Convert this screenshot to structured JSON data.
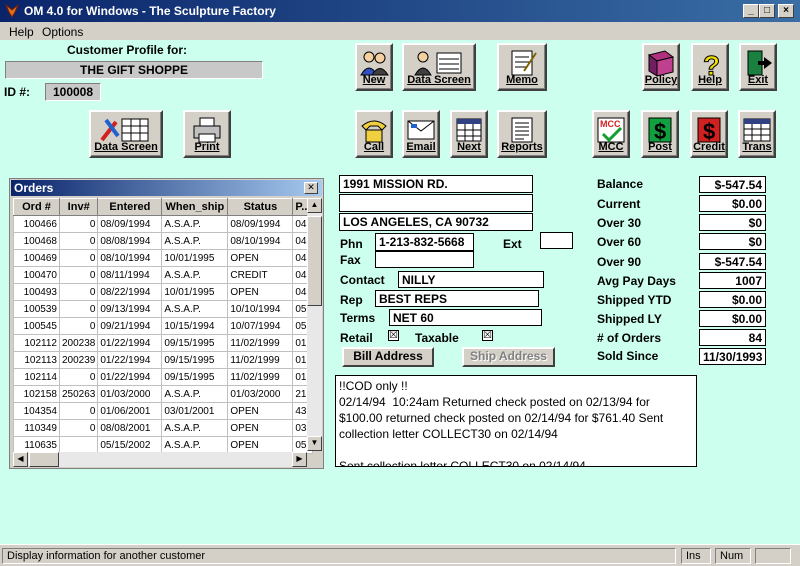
{
  "window": {
    "title": "OM 4.0 for Windows - The Sculpture Factory"
  },
  "menu": {
    "help": "Help",
    "options": "Options"
  },
  "profile": {
    "heading": "Customer Profile for:",
    "name": "THE GIFT SHOPPE",
    "id_label": "ID #:",
    "id": "100008"
  },
  "toolbar": {
    "new": "New",
    "data_screen": "Data Screen",
    "memo": "Memo",
    "policy": "Policy",
    "help": "Help",
    "exit": "Exit",
    "data_screen2": "Data Screen",
    "print": "Print",
    "call": "Call",
    "email": "Email",
    "next": "Next",
    "reports": "Reports",
    "mcc": "MCC",
    "post": "Post",
    "credit": "Credit",
    "trans": "Trans"
  },
  "orders": {
    "title": "Orders",
    "columns": [
      "Ord #",
      "Inv#",
      "Entered",
      "When_ship",
      "Status",
      "P..."
    ],
    "rows": [
      [
        "100466",
        "0",
        "08/09/1994",
        "A.S.A.P.",
        "08/09/1994",
        "04"
      ],
      [
        "100468",
        "0",
        "08/08/1994",
        "A.S.A.P.",
        "08/10/1994",
        "04"
      ],
      [
        "100469",
        "0",
        "08/10/1994",
        "10/01/1995",
        "OPEN",
        "04"
      ],
      [
        "100470",
        "0",
        "08/11/1994",
        "A.S.A.P.",
        "CREDIT",
        "04"
      ],
      [
        "100493",
        "0",
        "08/22/1994",
        "10/01/1995",
        "OPEN",
        "04"
      ],
      [
        "100539",
        "0",
        "09/13/1994",
        "A.S.A.P.",
        "10/10/1994",
        "05"
      ],
      [
        "100545",
        "0",
        "09/21/1994",
        "10/15/1994",
        "10/07/1994",
        "05"
      ],
      [
        "102112",
        "200238",
        "01/22/1994",
        "09/15/1995",
        "11/02/1999",
        "01"
      ],
      [
        "102113",
        "200239",
        "01/22/1994",
        "09/15/1995",
        "11/02/1999",
        "01"
      ],
      [
        "102114",
        "0",
        "01/22/1994",
        "09/15/1995",
        "11/02/1999",
        "01"
      ],
      [
        "102158",
        "250263",
        "01/03/2000",
        "A.S.A.P.",
        "01/03/2000",
        "21"
      ],
      [
        "104354",
        "0",
        "01/06/2001",
        "03/01/2001",
        "OPEN",
        "43"
      ],
      [
        "110349",
        "0",
        "08/08/2001",
        "A.S.A.P.",
        "OPEN",
        "03"
      ],
      [
        "110635",
        "",
        "05/15/2002",
        "A.S.A.P.",
        "OPEN",
        "05"
      ]
    ]
  },
  "address": {
    "line1": "1991 MISSION RD.",
    "line2": "",
    "city": "LOS ANGELES, CA 90732",
    "phn_label": "Phn",
    "phone": "1-213-832-5668",
    "ext_label": "Ext",
    "ext": "",
    "fax_label": "Fax",
    "fax": "",
    "contact_label": "Contact",
    "contact": "NILLY",
    "rep_label": "Rep",
    "rep": "BEST REPS",
    "terms_label": "Terms",
    "terms": "NET 60",
    "retail_label": "Retail",
    "retail_checked": "☒",
    "taxable_label": "Taxable",
    "taxable_checked": "☒",
    "bill_address": "Bill Address",
    "ship_address": "Ship Address"
  },
  "account": {
    "balance_label": "Balance",
    "balance": "$-547.54",
    "current_label": "Current",
    "current": "$0.00",
    "over30_label": "Over 30",
    "over30": "$0",
    "over60_label": "Over 60",
    "over60": "$0",
    "over90_label": "Over 90",
    "over90": "$-547.54",
    "avgpay_label": "Avg Pay Days",
    "avgpay": "1007",
    "ytd_label": "Shipped YTD",
    "ytd": "$0.00",
    "ly_label": "Shipped LY",
    "ly": "$0.00",
    "orders_label": "# of Orders",
    "orders": "84",
    "since_label": "Sold Since",
    "since": "11/30/1993"
  },
  "notes": "!!COD only !!\n02/14/94  10:24am Returned check posted on 02/13/94 for $100.00 returned check posted on 02/14/94 for $761.40 Sent collection letter COLLECT30 on 02/14/94\n\nSent collection letter COLLECT30 on 02/14/94",
  "status": {
    "message": "Display information for another customer",
    "ins": "Ins",
    "num": "Num"
  },
  "colors": {
    "client_bg": "#ccffee",
    "titlebar": "#0a246a",
    "chrome": "#d4d0c8"
  }
}
